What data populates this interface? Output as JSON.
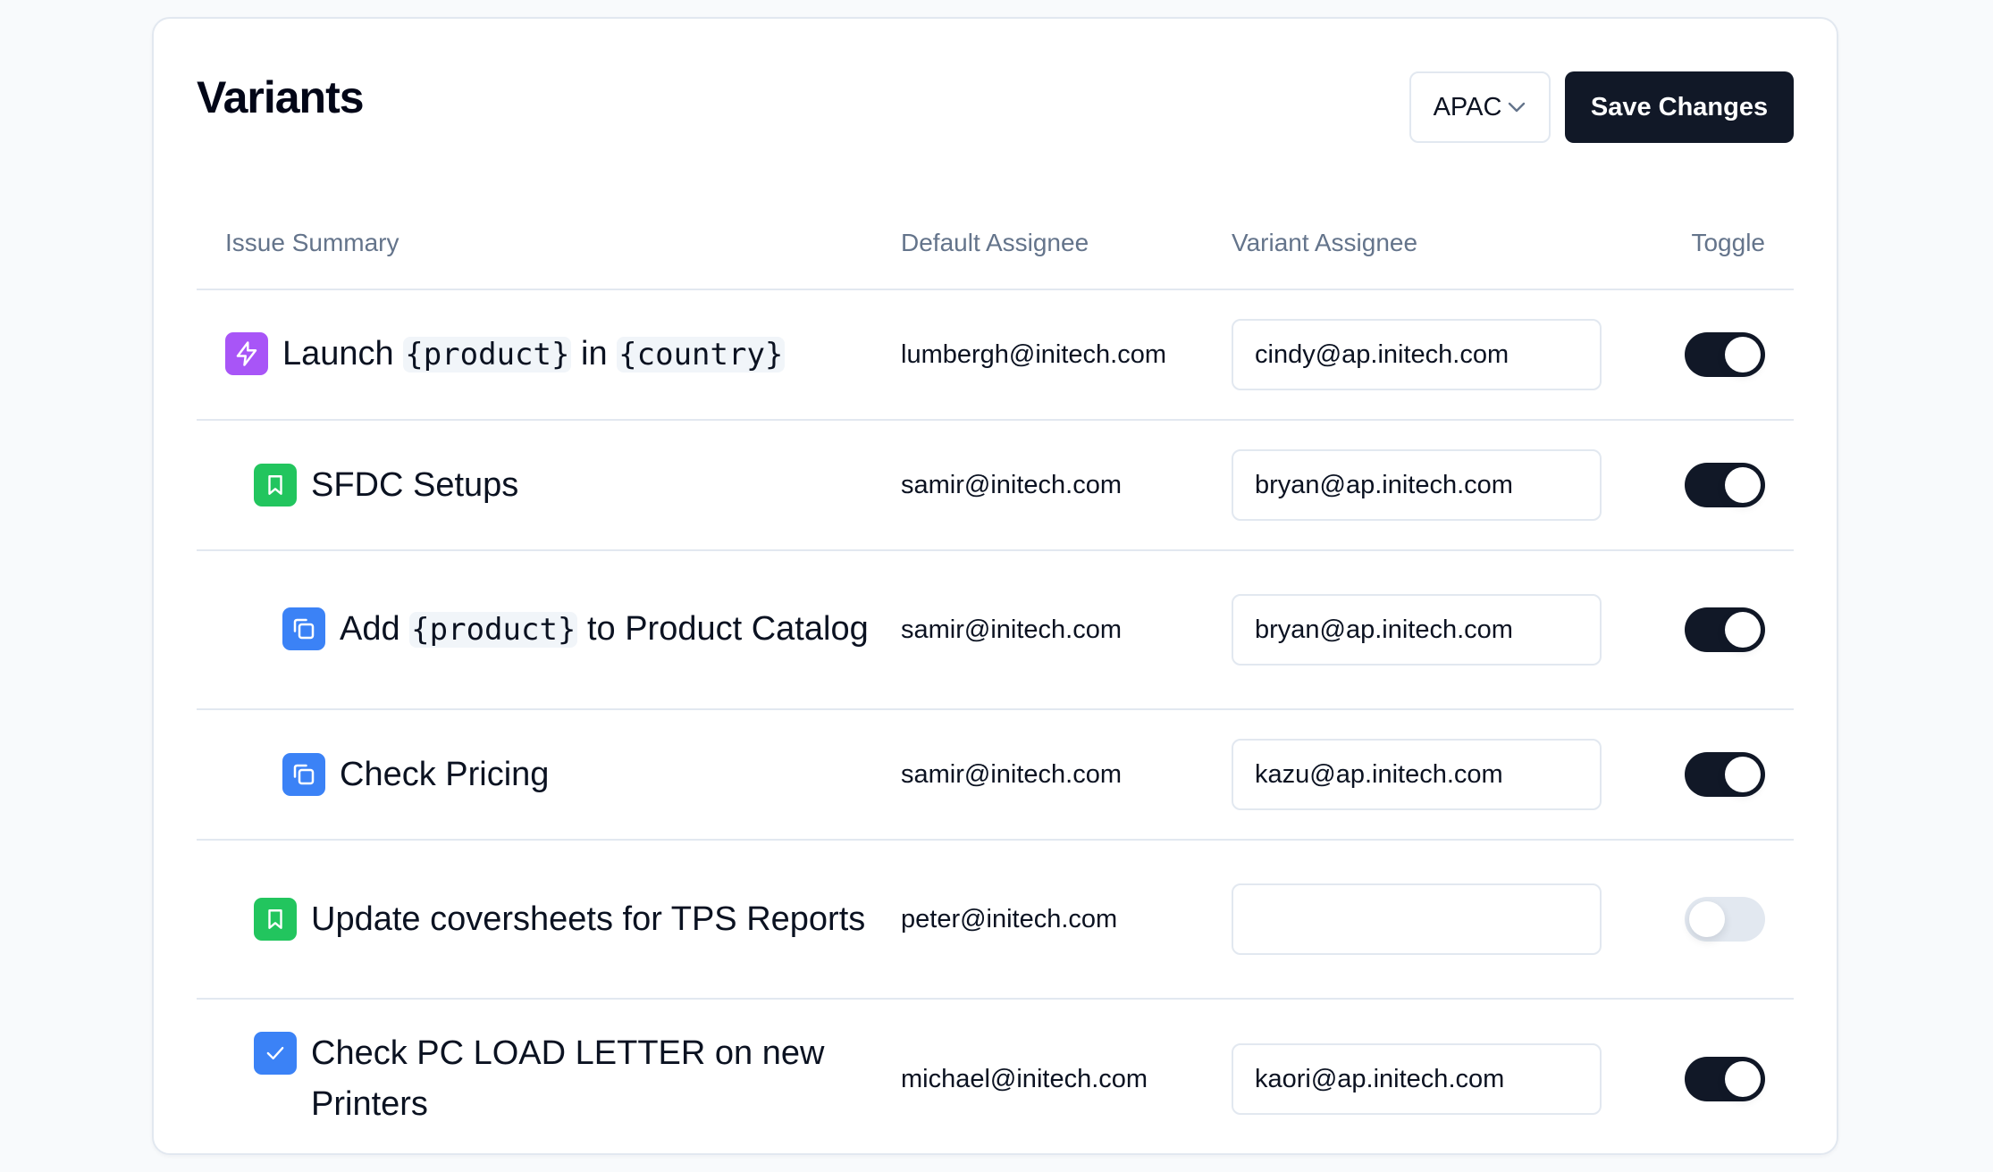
{
  "header": {
    "title": "Variants",
    "region_select": {
      "value": "APAC",
      "icon": "chevron-down-icon"
    },
    "save_label": "Save Changes"
  },
  "colors": {
    "epic": "#a855f7",
    "story": "#22c55e",
    "subtask": "#3b82f6",
    "task": "#3b82f6",
    "primary_button": "#111827",
    "toggle_on": "#111827",
    "toggle_off": "#e2e8f0"
  },
  "table": {
    "columns": {
      "summary": "Issue Summary",
      "default_assignee": "Default Assignee",
      "variant_assignee": "Variant Assignee",
      "toggle": "Toggle"
    },
    "rows": [
      {
        "type": "epic",
        "icon": "lightning-icon",
        "level": 0,
        "summary_parts": [
          {
            "text": "Launch ",
            "code": false
          },
          {
            "text": "{product}",
            "code": true
          },
          {
            "text": " in ",
            "code": false
          },
          {
            "text": "{country}",
            "code": true
          }
        ],
        "default_assignee": "lumbergh@initech.com",
        "variant_assignee": "cindy@ap.initech.com",
        "enabled": true
      },
      {
        "type": "story",
        "icon": "bookmark-icon",
        "level": 1,
        "summary_parts": [
          {
            "text": "SFDC Setups",
            "code": false
          }
        ],
        "default_assignee": "samir@initech.com",
        "variant_assignee": "bryan@ap.initech.com",
        "enabled": true
      },
      {
        "type": "subtask",
        "icon": "subtask-icon",
        "level": 2,
        "summary_parts": [
          {
            "text": "Add ",
            "code": false
          },
          {
            "text": "{product}",
            "code": true
          },
          {
            "text": " to Product Catalog",
            "code": false
          }
        ],
        "default_assignee": "samir@initech.com",
        "variant_assignee": "bryan@ap.initech.com",
        "enabled": true
      },
      {
        "type": "subtask",
        "icon": "subtask-icon",
        "level": 2,
        "summary_parts": [
          {
            "text": "Check Pricing",
            "code": false
          }
        ],
        "default_assignee": "samir@initech.com",
        "variant_assignee": "kazu@ap.initech.com",
        "enabled": true
      },
      {
        "type": "story",
        "icon": "bookmark-icon",
        "level": 1,
        "summary_parts": [
          {
            "text": "Update coversheets for TPS Reports",
            "code": false
          }
        ],
        "default_assignee": "peter@initech.com",
        "variant_assignee": "",
        "enabled": false
      },
      {
        "type": "task",
        "icon": "checkbox-icon",
        "level": 1,
        "summary_parts": [
          {
            "text": "Check PC LOAD LETTER on new Printers",
            "code": false
          }
        ],
        "default_assignee": "michael@initech.com",
        "variant_assignee": "kaori@ap.initech.com",
        "enabled": true
      }
    ]
  }
}
